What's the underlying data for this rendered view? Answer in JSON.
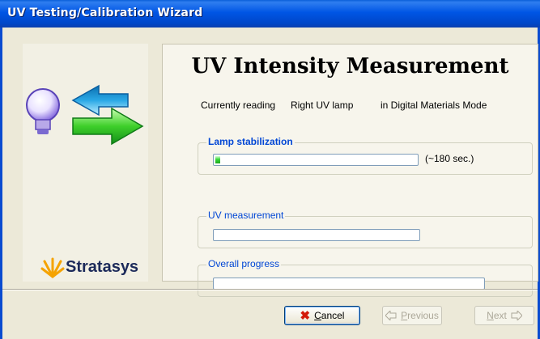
{
  "window": {
    "title": "UV Testing/Calibration Wizard"
  },
  "sidebar": {
    "logo_text": "Stratasys",
    "illustration_icon": "lamp-with-arrows-icon"
  },
  "main": {
    "heading": "UV Intensity Measurement",
    "status": {
      "prefix": "Currently reading",
      "lamp": "Right UV lamp",
      "mode": "in  Digital Materials Mode"
    },
    "groups": [
      {
        "title": "Lamp stabilization",
        "bold": true,
        "progress": 0.02,
        "note": "(~180 sec.)"
      },
      {
        "title": "UV measurement",
        "bold": false,
        "progress": 0
      },
      {
        "title": "Overall progress",
        "bold": false,
        "progress": 0
      }
    ]
  },
  "buttons": {
    "cancel": {
      "label": "Cancel",
      "mnemonic": "C",
      "rest": "ancel",
      "icon": "red-x-icon",
      "enabled": true
    },
    "previous": {
      "label": "Previous",
      "mnemonic": "P",
      "rest": "revious",
      "icon": "left-arrow-icon",
      "enabled": false
    },
    "next": {
      "label": "Next",
      "mnemonic": "N",
      "rest": "ext",
      "icon": "right-arrow-icon",
      "enabled": false
    }
  },
  "colors": {
    "title_bar": "#0055e5",
    "group_title": "#0046d5",
    "progress_fill": "#36d636",
    "cancel_icon": "#d31a0a",
    "logo_star": "#f5a300"
  }
}
